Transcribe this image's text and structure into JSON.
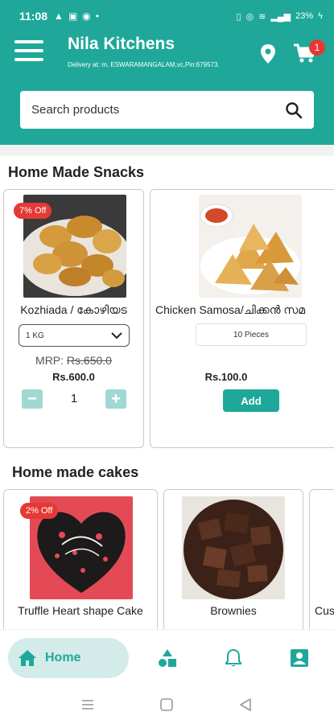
{
  "status_bar": {
    "time": "11:08",
    "battery": "23%"
  },
  "header": {
    "app_title": "Nila Kitchens",
    "delivery_text": "Delivery at: m, ESWARAMANGALAM,vc,Pin:679573.",
    "cart_count": "1",
    "colors": {
      "primary": "#1fa89a",
      "badge": "#e53935"
    }
  },
  "search": {
    "placeholder": "Search products"
  },
  "sections": [
    {
      "title": "Home Made Snacks",
      "products": [
        {
          "name": "Kozhiada / കോഴിയട",
          "discount": "7% Off",
          "variant": "1 KG",
          "mrp_label": "MRP: ",
          "mrp_value": "Rs.650.0",
          "price": "Rs.600.0",
          "quantity": "1",
          "image": "fried-snacks-photo"
        },
        {
          "name": "Chicken Samosa/ചിക്കൻ സമ",
          "variant": "10 Pieces",
          "price": "Rs.100.0",
          "add_label": "Add",
          "image": "samosa-photo"
        }
      ]
    },
    {
      "title": "Home made cakes",
      "products": [
        {
          "name": "Truffle Heart shape Cake",
          "discount": "2% Off",
          "image": "heart-cake-photo"
        },
        {
          "name": "Brownies",
          "image": "brownies-photo"
        },
        {
          "name": "Cus",
          "image": ""
        }
      ]
    }
  ],
  "bottom_nav": {
    "home_label": "Home",
    "items": [
      "home-icon",
      "categories-icon",
      "notifications-icon",
      "profile-icon"
    ]
  }
}
